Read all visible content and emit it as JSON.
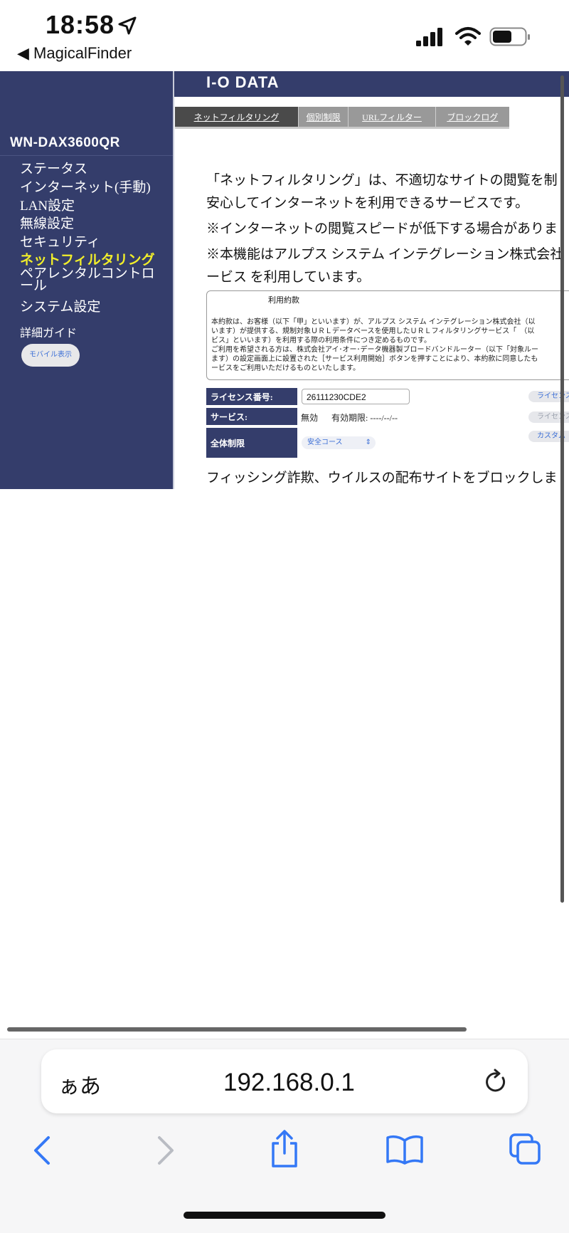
{
  "status_bar": {
    "time": "18:58",
    "back_app": "◀ MagicalFinder"
  },
  "sidebar": {
    "model": "WN-DAX3600QR",
    "items": [
      {
        "label": "ステータス"
      },
      {
        "label": "インターネット(手動)"
      },
      {
        "label": "LAN設定"
      },
      {
        "label": "無線設定"
      },
      {
        "label": "セキュリティ"
      },
      {
        "label": "ネットフィルタリング",
        "active": true
      },
      {
        "label": "ペアレンタルコントロール"
      },
      {
        "label": "システム設定"
      }
    ],
    "guide": "詳細ガイド",
    "mobile_button": "モバイル表示"
  },
  "header": {
    "brand": "I-O DATA"
  },
  "tabs": [
    {
      "label": "ネットフィルタリング",
      "active": true
    },
    {
      "label": "個別制限"
    },
    {
      "label": "URLフィルター"
    },
    {
      "label": "ブロックログ"
    }
  ],
  "main": {
    "intro_1": "「ネットフィルタリング」は、不適切なサイトの閲覧を制",
    "intro_2": "安心してインターネットを利用できるサービスです。",
    "note_1": "※インターネットの閲覧スピードが低下する場合がありま",
    "note_2": "※本機能はアルプス システム インテグレーション株式会社",
    "note_3": "ービス を利用しています。",
    "terms": {
      "title": "利用約款",
      "lines": [
        "本約款は、お客様（以下「甲」といいます）が、アルプス システム インテグレーション株式会社（以",
        "います）が提供する、規制対象ＵＲＬデータベースを使用したＵＲＬフィルタリングサービス「　（以",
        "ビス」といいます）を利用する際の利用条件につき定めるものです。",
        "ご利用を希望される方は、株式会社アイ･オー･データ機器製ブロードバンドルーター（以下「対象ルー",
        "ます）の設定画面上に設置された［サービス利用開始］ボタンを押すことにより、本約款に同意したも",
        "ービスをご利用いただけるものといたします。"
      ]
    },
    "license_label": "ライセンス番号:",
    "license_value": "26111230CDE2",
    "service_label": "サービス:",
    "service_value": "無効",
    "expiry_label": "有効期限: ----/--/--",
    "overall_label": "全体制限",
    "course_value": "安全コース",
    "btn_license_1": "ライセンス",
    "btn_license_2": "ライセンス",
    "btn_custom": "カスタム",
    "footer_text": "フィッシング詐欺、ウイルスの配布サイトをブロックしま"
  },
  "browser": {
    "aa": "ぁあ",
    "url": "192.168.0.1"
  }
}
